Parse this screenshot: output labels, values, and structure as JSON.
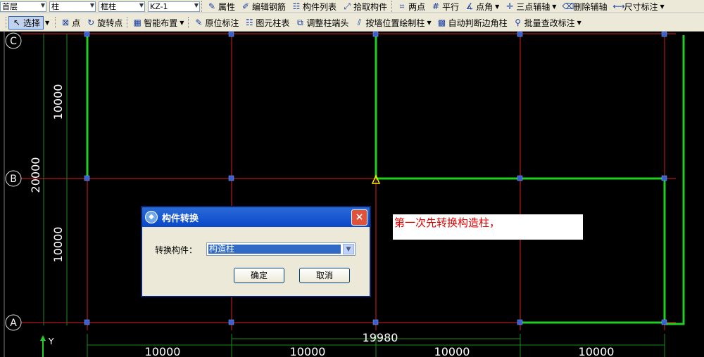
{
  "toolbar1": {
    "floor": "首层",
    "category": "柱",
    "type": "框柱",
    "component": "KZ-1",
    "properties": "属性",
    "edit_rebar": "编辑钢筋",
    "component_list": "构件列表",
    "pick_component": "拾取构件",
    "two_points": "两点",
    "parallel": "平行",
    "point_angle": "点角",
    "three_point_axis": "三点辅轴",
    "delete_axis": "删除辅轴",
    "dimension": "尺寸标注"
  },
  "toolbar2": {
    "select": "选择",
    "point": "点",
    "rotate_point": "旋转点",
    "smart_layout": "智能布置",
    "in_place_label": "原位标注",
    "element_table": "图元柱表",
    "adjust_column_end": "调整柱端头",
    "draw_by_wall": "按墙位置绘制柱",
    "auto_corner": "自动判断边角柱",
    "batch_label": "批量查改标注"
  },
  "axes": {
    "left_labels": [
      "C",
      "B",
      "A"
    ],
    "v_dims": [
      "10000",
      "10000"
    ],
    "v_total": "20000",
    "bottom_dims": [
      "10000",
      "10000",
      "10000",
      "10000"
    ],
    "bottom_partial": "19980",
    "ucs_y": "Y"
  },
  "dialog": {
    "title": "构件转换",
    "label": "转换构件：",
    "selected": "构造柱",
    "ok": "确定",
    "cancel": "取消",
    "close": "×"
  },
  "note": "第一次先转换构造柱，",
  "colors": {
    "grid_line": "#d42020",
    "dim_line": "#1c8a1c",
    "wall": "#22cc22",
    "node": "#3a5fd0"
  }
}
